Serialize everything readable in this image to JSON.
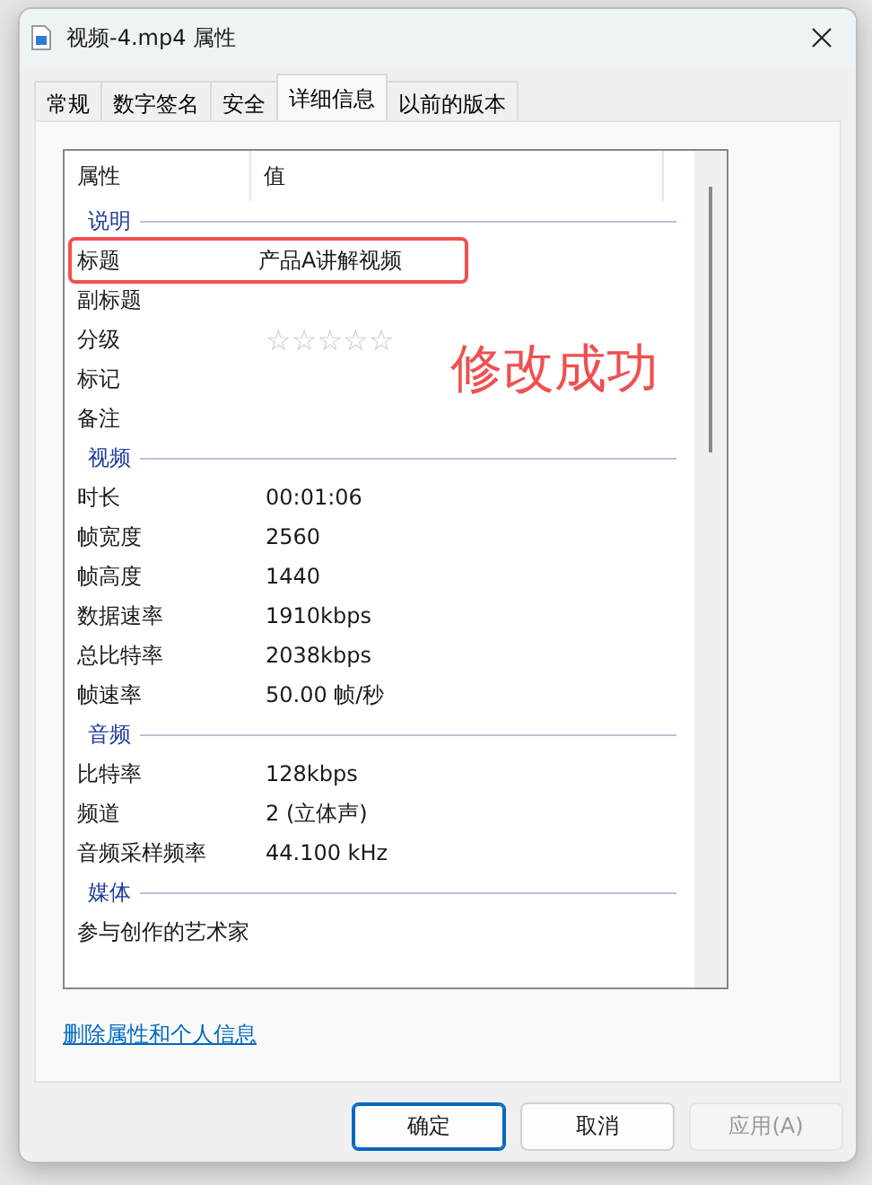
{
  "window": {
    "title": "视频-4.mp4 属性"
  },
  "tabs": [
    {
      "label": "常规",
      "selected": false
    },
    {
      "label": "数字签名",
      "selected": false
    },
    {
      "label": "安全",
      "selected": false
    },
    {
      "label": "详细信息",
      "selected": true
    },
    {
      "label": "以前的版本",
      "selected": false
    }
  ],
  "table": {
    "columns": [
      "属性",
      "值"
    ],
    "rows": [
      {
        "kind": "section",
        "label": "说明"
      },
      {
        "kind": "property",
        "name": "标题",
        "value": "产品A讲解视频",
        "highlighted": true
      },
      {
        "kind": "property",
        "name": "副标题",
        "highlighted": false
      },
      {
        "kind": "rating",
        "name": "分级",
        "stars": 0,
        "highlighted": false
      },
      {
        "kind": "property",
        "name": "标记",
        "highlighted": false
      },
      {
        "kind": "property",
        "name": "备注",
        "highlighted": false
      },
      {
        "kind": "section",
        "label": "视频"
      },
      {
        "kind": "property",
        "name": "时长",
        "value": "00:01:06",
        "highlighted": false
      },
      {
        "kind": "property",
        "name": "帧宽度",
        "value": "2560",
        "highlighted": false
      },
      {
        "kind": "property",
        "name": "帧高度",
        "value": "1440",
        "highlighted": false
      },
      {
        "kind": "property",
        "name": "数据速率",
        "value": "1910kbps",
        "highlighted": false
      },
      {
        "kind": "property",
        "name": "总比特率",
        "value": "2038kbps",
        "highlighted": false
      },
      {
        "kind": "property",
        "name": "帧速率",
        "value": "50.00 帧/秒",
        "highlighted": false
      },
      {
        "kind": "section",
        "label": "音频"
      },
      {
        "kind": "property",
        "name": "比特率",
        "value": "128kbps",
        "highlighted": false
      },
      {
        "kind": "property",
        "name": "频道",
        "value": "2 (立体声)",
        "highlighted": false
      },
      {
        "kind": "property",
        "name": "音频采样频率",
        "value": "44.100 kHz",
        "highlighted": false
      },
      {
        "kind": "section",
        "label": "媒体"
      },
      {
        "kind": "property",
        "name": "参与创作的艺术家",
        "highlighted": false
      }
    ]
  },
  "annotation": {
    "text": "修改成功"
  },
  "link": "删除属性和个人信息",
  "buttons": [
    {
      "label": "确定",
      "kind": "default",
      "disabled": false
    },
    {
      "label": "取消",
      "kind": "normal",
      "disabled": false
    },
    {
      "label": "应用(A)",
      "kind": "normal",
      "disabled": true
    }
  ]
}
